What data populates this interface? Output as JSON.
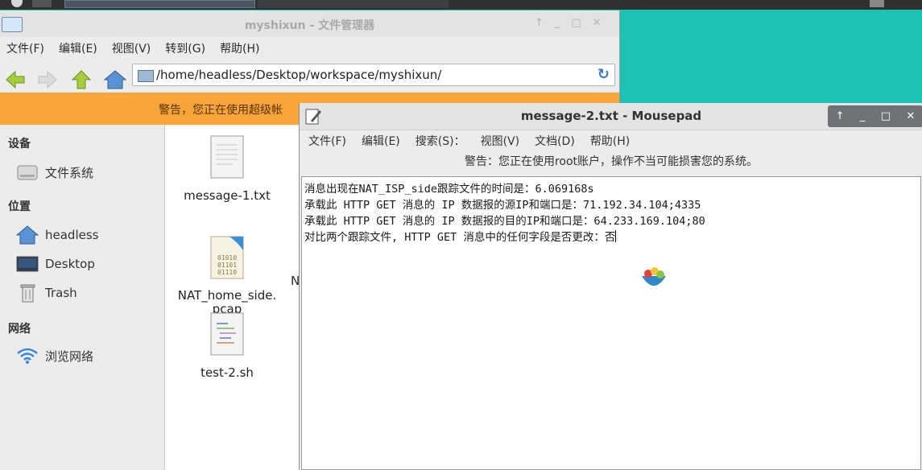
{
  "file_manager": {
    "title": "myshixun - 文件管理器",
    "menu": [
      "文件(F)",
      "编辑(E)",
      "视图(V)",
      "转到(G)",
      "帮助(H)"
    ],
    "path": "/home/headless/Desktop/workspace/myshixun/",
    "warning": "警告，您正在使用超级帐",
    "sidebar": {
      "devices_heading": "设备",
      "devices": [
        {
          "label": "文件系统",
          "icon": "drive-icon"
        }
      ],
      "places_heading": "位置",
      "places": [
        {
          "label": "headless",
          "icon": "home-icon"
        },
        {
          "label": "Desktop",
          "icon": "desktop-icon"
        },
        {
          "label": "Trash",
          "icon": "trash-icon"
        }
      ],
      "network_heading": "网络",
      "network": [
        {
          "label": "浏览网络",
          "icon": "wifi-icon"
        }
      ]
    },
    "files": [
      {
        "name": "message-1.txt",
        "icon": "text-file-icon"
      },
      {
        "name": "NAT_home_side.\npcap",
        "icon": "binary-file-icon"
      },
      {
        "name": "test-2.sh",
        "icon": "script-file-icon"
      }
    ],
    "partial_glyph": "N"
  },
  "mousepad": {
    "title": "message-2.txt - Mousepad",
    "menu": [
      "文件(F)",
      "编辑(E)",
      "搜索(S)：",
      "视图(V)",
      "文档(D)",
      "帮助(H)"
    ],
    "warning": "警告：您正在使用root账户，操作不当可能损害您的系统。",
    "lines": [
      "消息出现在NAT_ISP_side跟踪文件的时间是：6.069168s",
      "承载此 HTTP GET 消息的 IP 数据报的源IP和端口是：71.192.34.104;4335",
      "承载此 HTTP GET 消息的 IP 数据报的目的IP和端口是：64.233.169.104;80",
      "对比两个跟踪文件, HTTP GET 消息中的任何字段是否更改：否"
    ]
  },
  "colors": {
    "desktop": "#1ec1b4",
    "warning_bar": "#f7a53a",
    "taskbar": "#2f3133"
  }
}
